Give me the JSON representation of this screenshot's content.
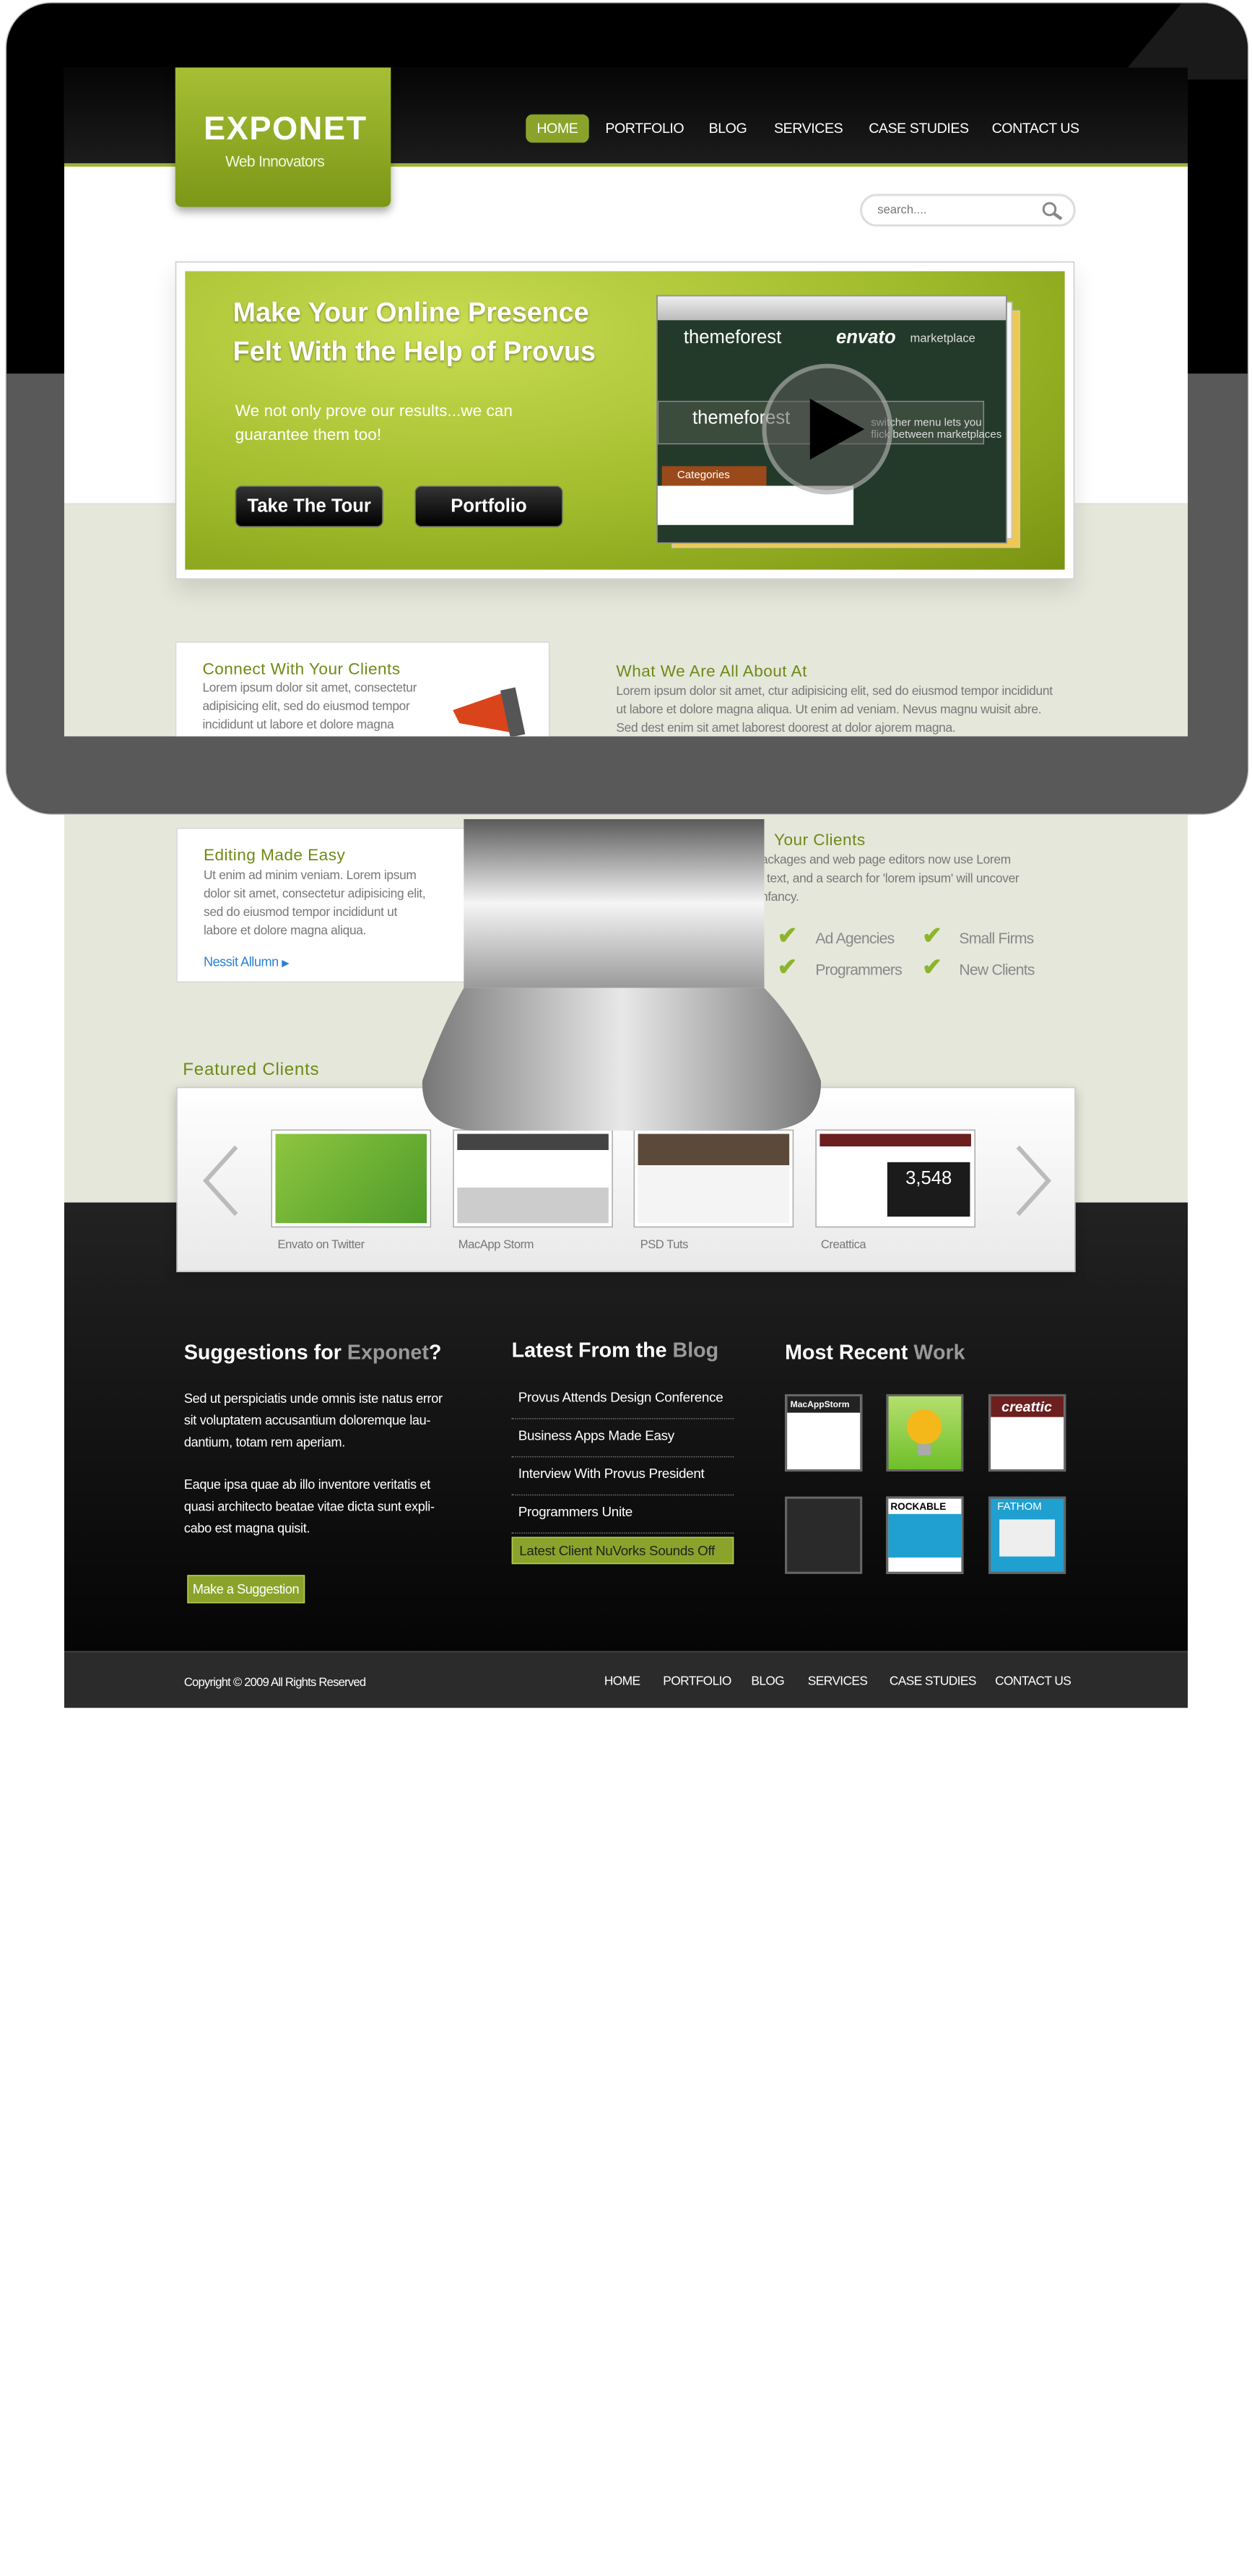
{
  "logo": {
    "name": "EXPONET",
    "tagline": "Web Innovators"
  },
  "nav": [
    "HOME",
    "PORTFOLIO",
    "BLOG",
    "SERVICES",
    "CASE STUDIES",
    "CONTACT US"
  ],
  "search": {
    "placeholder": "search...."
  },
  "hero": {
    "title_line1": "Make Your Online Presence",
    "title_line2": "Felt With the Help of Provus",
    "text_line1": "We not only prove our results...we can",
    "text_line2": "guarantee them too!",
    "btn_tour": "Take The Tour",
    "btn_portfolio": "Portfolio",
    "video": {
      "brand1": "themeforest",
      "brand2": "envato",
      "brand2_suffix": "marketplace",
      "tab": "Categories",
      "hint1": "switcher menu lets you",
      "hint2": "flick between marketplaces"
    }
  },
  "connect": {
    "title": "Connect With Your Clients",
    "l1": "Lorem ipsum dolor sit amet, consectetur",
    "l2": "adipisicing elit, sed do eiusmod tempor",
    "l3": "incididunt ut labore et dolore magna"
  },
  "about": {
    "title": "What We Are All About At",
    "l1": "Lorem ipsum dolor sit amet, ctur adipisicing elit, sed do eiusmod tempor incididunt",
    "l2": "ut labore et dolore magna aliqua. Ut enim ad veniam. Nevus magnu wuisit abre.",
    "l3": "Sed dest enim sit amet laborest doorest at dolor ajorem magna."
  },
  "editing": {
    "title": "Editing Made Easy",
    "l1": "Ut enim ad minim veniam. Lorem ipsum",
    "l2": "dolor sit amet, consectetur adipisicing elit,",
    "l3": "sed do eiusmod tempor incididunt ut",
    "l4": "labore et dolore magna aliqua.",
    "link": "Nessit Allumn"
  },
  "clients_right": {
    "title": "Your Clients",
    "l1": "ackages and web page editors now use Lorem",
    "l2": "l text, and a search for 'lorem ipsum' will uncover",
    "l3": "nfancy."
  },
  "checklist": [
    "Ad Agencies",
    "Small Firms",
    "Programmers",
    "New Clients"
  ],
  "featured": {
    "title": "Featured Clients",
    "items": [
      "Envato on Twitter",
      "MacApp Storm",
      "PSD Tuts",
      "Creattica"
    ],
    "creattica_count": "3,548"
  },
  "suggestions": {
    "title_a": "Suggestions for ",
    "title_b": "Exponet",
    "title_c": "?",
    "p1_l1": "Sed ut perspiciatis unde omnis iste natus error",
    "p1_l2": "sit voluptatem accusantium doloremque lau-",
    "p1_l3": "dantium, totam rem aperiam.",
    "p2_l1": "Eaque ipsa quae ab illo inventore veritatis et",
    "p2_l2": "quasi architecto beatae vitae dicta sunt expli-",
    "p2_l3": "cabo est magna quisit.",
    "button": "Make a Suggestion"
  },
  "blog": {
    "title_a": "Latest From the ",
    "title_b": "Blog",
    "items": [
      "Provus Attends Design Conference",
      "Business Apps Made Easy",
      "Interview With Provus President",
      "Programmers Unite",
      "Latest Client NuVorks Sounds Off"
    ]
  },
  "work": {
    "title_a": "Most Recent ",
    "title_b": "Work",
    "labels": [
      "MacAppStorm",
      "creattic",
      "ROCKABLE",
      "FATHOM"
    ]
  },
  "footer": {
    "copyright": "Copyright © 2009 All Rights Reserved",
    "nav": [
      "HOME",
      "PORTFOLIO",
      "BLOG",
      "SERVICES",
      "CASE STUDIES",
      "CONTACT US"
    ]
  },
  "colors": {
    "accent": "#8ba32a",
    "dark": "#000000",
    "bg_light": "#e6e7db"
  }
}
